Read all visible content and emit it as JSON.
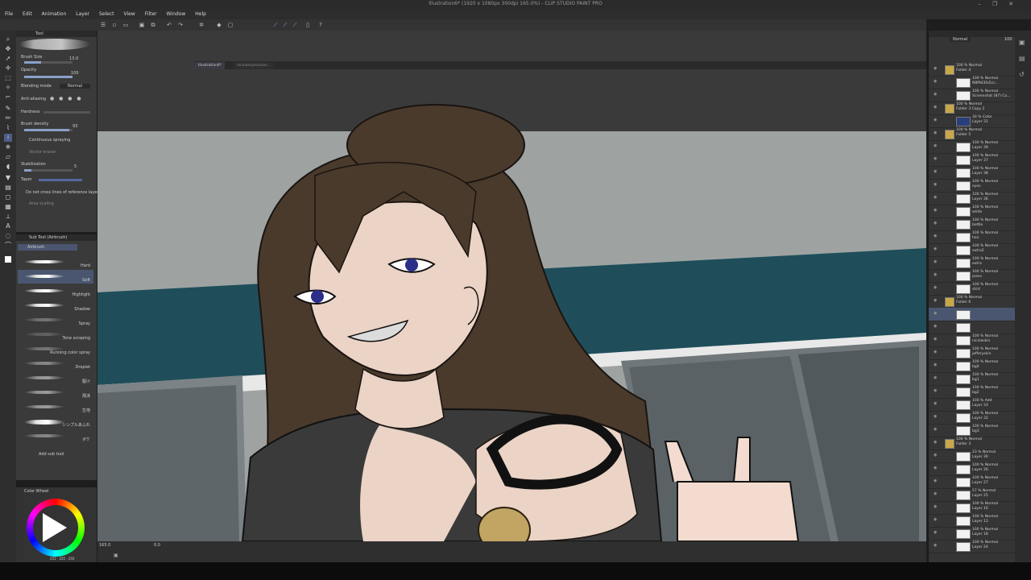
{
  "window": {
    "title": "Illustration6* (1920 x 1080px 300dpi 165.0%) - CLIP STUDIO PAINT PRO",
    "controls": [
      "–",
      "❐",
      "✕"
    ]
  },
  "menu": [
    "File",
    "Edit",
    "Animation",
    "Layer",
    "Select",
    "View",
    "Filter",
    "Window",
    "Help"
  ],
  "tabs": [
    "Illustration6*",
    "nicolaexpression..."
  ],
  "tool_property": {
    "header": "Tool",
    "brush_size_label": "Brush Size",
    "brush_size_value": "13.0",
    "opacity_label": "Opacity",
    "opacity_value": "100",
    "blending_label": "Blending mode",
    "blending_value": "Normal",
    "antialias_label": "Anti-aliasing",
    "hardness_label": "Hardness",
    "density_label": "Brush density",
    "density_value": "93",
    "spray_label": "Continuous spraying",
    "vector_label": "Vector eraser",
    "stabilization_label": "Stabilization",
    "stabilization_value": "5",
    "taper_label": "Taper",
    "crossref_label": "Do not cross lines of reference layer",
    "area_label": "Area scaling",
    "opacity_fill": 1.0,
    "brush_size_fill": 0.35,
    "density_fill": 0.93,
    "stabilization_fill": 0.15
  },
  "sub_tool": {
    "header": "Sub Tool (Airbrush)",
    "group": "Airbrush",
    "items": [
      "Hard",
      "Soft",
      "Highlight",
      "Shadow",
      "Spray",
      "Tone scraping",
      "Running color spray",
      "Droplet",
      "駆け",
      "飛沫",
      "生地",
      "シンプルあふれ",
      "ボケ"
    ],
    "add_label": "Add sub tool"
  },
  "color_panel": {
    "header": "Color Wheel",
    "readout": "255 · 255 · 255"
  },
  "layers": [
    {
      "txt": "100 % Normal\nFolder 4",
      "type": "folder"
    },
    {
      "txt": "100 % Normal\nN8f9d3fa5cc...",
      "type": "layer"
    },
    {
      "txt": "100 % Normal\nScreenshot (87) Co...",
      "type": "layer"
    },
    {
      "txt": "100 % Normal\nFolder 3 Copy 2",
      "type": "folder"
    },
    {
      "txt": "30 % Color\nLayer 31",
      "type": "layer",
      "thumb": "#2a3f7a"
    },
    {
      "txt": "100 % Normal\nFolder 5",
      "type": "folder"
    },
    {
      "txt": "100 % Normal\nLayer 39",
      "type": "layer"
    },
    {
      "txt": "100 % Normal\nLayer 37",
      "type": "layer"
    },
    {
      "txt": "100 % Normal\nLayer 38",
      "type": "layer"
    },
    {
      "txt": "100 % Normal\neyes",
      "type": "layer"
    },
    {
      "txt": "100 % Normal\nLayer 36",
      "type": "layer"
    },
    {
      "txt": "100 % Normal\nwhite",
      "type": "layer"
    },
    {
      "txt": "100 % Normal\nbottle",
      "type": "layer"
    },
    {
      "txt": "100 % Normal\nhair",
      "type": "layer"
    },
    {
      "txt": "100 % Normal\nextra2",
      "type": "layer"
    },
    {
      "txt": "100 % Normal\nextra",
      "type": "layer"
    },
    {
      "txt": "100 % Normal\njeans",
      "type": "layer"
    },
    {
      "txt": "100 % Normal\nshirt",
      "type": "layer"
    },
    {
      "txt": "100 % Normal\nFolder 6",
      "type": "folder"
    },
    {
      "txt": "",
      "type": "selected"
    },
    {
      "txt": "",
      "type": "layer"
    },
    {
      "txt": "100 % Normal\nnicolaskin",
      "type": "layer"
    },
    {
      "txt": "100 % Normal\njefferyskin",
      "type": "layer"
    },
    {
      "txt": "100 % Normal\nbg0",
      "type": "layer"
    },
    {
      "txt": "100 % Normal\nbg1",
      "type": "layer"
    },
    {
      "txt": "100 % Normal\nbg2",
      "type": "layer"
    },
    {
      "txt": "100 % Add\nLayer 33",
      "type": "layer"
    },
    {
      "txt": "100 % Normal\nLayer 32",
      "type": "layer"
    },
    {
      "txt": "100 % Normal\nbg3",
      "type": "layer"
    },
    {
      "txt": "100 % Normal\nFolder 3",
      "type": "folder"
    },
    {
      "txt": "23 % Normal\nLayer 30",
      "type": "layer"
    },
    {
      "txt": "100 % Normal\nLayer 26",
      "type": "layer"
    },
    {
      "txt": "100 % Normal\nLayer 27",
      "type": "layer"
    },
    {
      "txt": "57 % Normal\nLayer 25",
      "type": "layer"
    },
    {
      "txt": "100 % Normal\nLayer 16",
      "type": "layer"
    },
    {
      "txt": "100 % Normal\nLayer 13",
      "type": "layer"
    },
    {
      "txt": "100 % Normal\nLayer 18",
      "type": "layer"
    },
    {
      "txt": "100 % Normal\nLayer 24",
      "type": "layer"
    }
  ],
  "layer_panel": {
    "blend": "Normal",
    "opacity": "100"
  },
  "status": {
    "zoom": "165.0",
    "angle": "0.0"
  },
  "colors": {
    "sky": "#9aa0a0",
    "wall": "#1f4e5a",
    "hair": "#4a3a2c",
    "shirt": "#3a3a3a",
    "skin": "#ebd3c6"
  }
}
